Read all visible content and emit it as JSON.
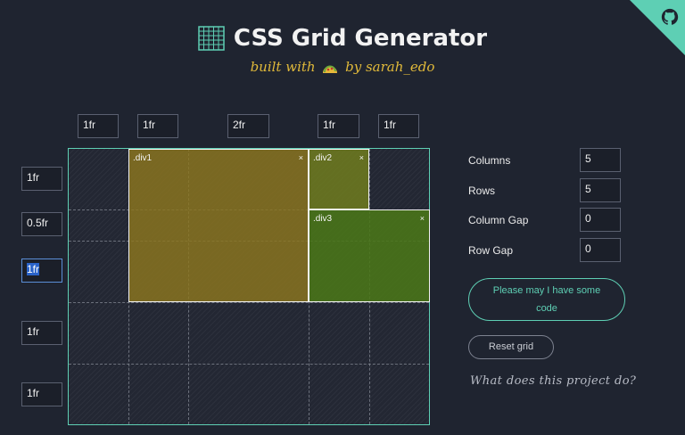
{
  "header": {
    "title": "CSS Grid Generator",
    "subtitle_before": "built with",
    "subtitle_after": "by sarah_edo"
  },
  "columns": [
    "1fr",
    "1fr",
    "2fr",
    "1fr",
    "1fr"
  ],
  "rows": [
    "1fr",
    "0.5fr",
    "1fr",
    "1fr",
    "1fr"
  ],
  "blocks": [
    {
      "label": ".div1",
      "close": "×"
    },
    {
      "label": ".div2",
      "close": "×"
    },
    {
      "label": ".div3",
      "close": "×"
    }
  ],
  "settings": {
    "columns_label": "Columns",
    "columns_value": "5",
    "rows_label": "Rows",
    "rows_value": "5",
    "column_gap_label": "Column Gap",
    "column_gap_value": "0",
    "row_gap_label": "Row Gap",
    "row_gap_value": "0"
  },
  "buttons": {
    "code": "Please may I have some code",
    "reset": "Reset grid"
  },
  "link": "What does this project do?",
  "icons": [
    "grid-icon",
    "taco-icon",
    "github-icon"
  ],
  "colors": {
    "accent": "#5ecfb4",
    "subtitle": "#e0b93a",
    "background": "#1f2430"
  }
}
